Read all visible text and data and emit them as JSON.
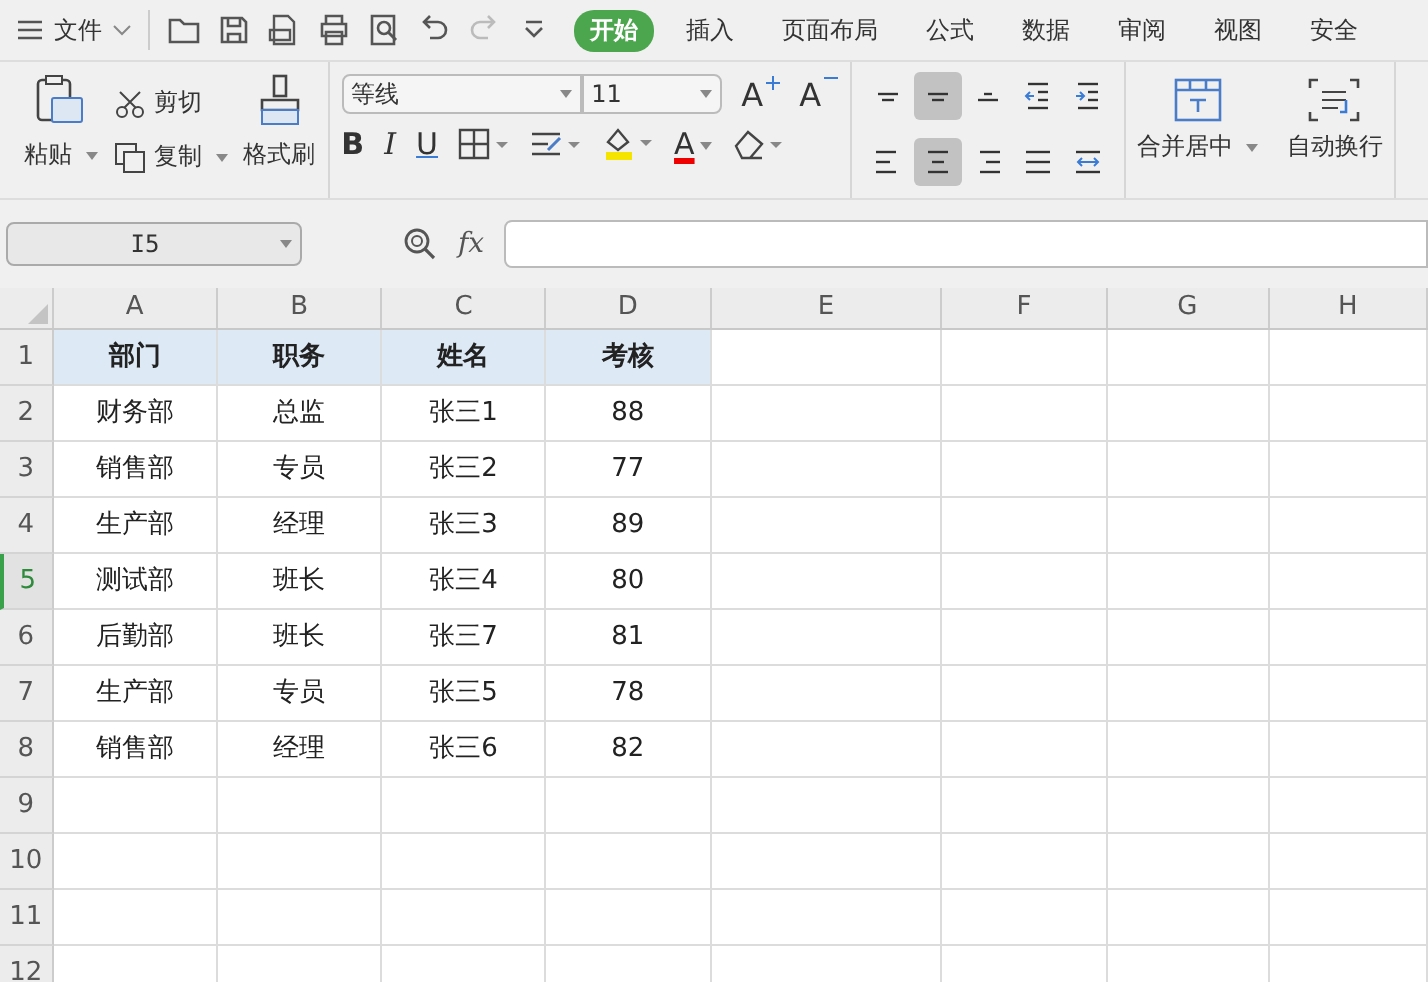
{
  "menu_bar": {
    "file_label": "文件",
    "tabs": [
      {
        "label": "开始",
        "selected": true
      },
      {
        "label": "插入",
        "selected": false
      },
      {
        "label": "页面布局",
        "selected": false
      },
      {
        "label": "公式",
        "selected": false
      },
      {
        "label": "数据",
        "selected": false
      },
      {
        "label": "审阅",
        "selected": false
      },
      {
        "label": "视图",
        "selected": false
      },
      {
        "label": "安全",
        "selected": false
      }
    ]
  },
  "ribbon": {
    "clipboard": {
      "paste": "粘贴",
      "cut": "剪切",
      "copy": "复制",
      "format_painter": "格式刷"
    },
    "font": {
      "family": "等线",
      "size": "11",
      "grow": "A",
      "shrink": "A",
      "bold": "B",
      "italic": "I",
      "underline": "U",
      "font_color": "A"
    },
    "alignment": [
      {
        "kind": "top",
        "selected": false
      },
      {
        "kind": "middle",
        "selected": true
      },
      {
        "kind": "bottom",
        "selected": false
      },
      {
        "kind": "outdent",
        "selected": false
      },
      {
        "kind": "indent",
        "selected": false
      },
      {
        "kind": "left",
        "selected": false
      },
      {
        "kind": "center",
        "selected": true
      },
      {
        "kind": "right",
        "selected": false
      },
      {
        "kind": "justify",
        "selected": false
      },
      {
        "kind": "distributed",
        "selected": false
      }
    ],
    "merge": "合并居中",
    "wrap": "自动换行"
  },
  "formula_bar": {
    "cell_ref": "I5",
    "fx": "fx"
  },
  "sheet": {
    "columns": [
      "A",
      "B",
      "C",
      "D",
      "E",
      "F",
      "G",
      "H"
    ],
    "rows": [
      {
        "number": "1",
        "kind": "heading",
        "selected": false,
        "cells": [
          "部门",
          "职务",
          "姓名",
          "考核"
        ]
      },
      {
        "number": "2",
        "kind": "data",
        "selected": false,
        "cells": [
          "财务部",
          "总监",
          "张三1",
          "88"
        ]
      },
      {
        "number": "3",
        "kind": "data",
        "selected": false,
        "cells": [
          "销售部",
          "专员",
          "张三2",
          "77"
        ]
      },
      {
        "number": "4",
        "kind": "data",
        "selected": false,
        "cells": [
          "生产部",
          "经理",
          "张三3",
          "89"
        ]
      },
      {
        "number": "5",
        "kind": "data",
        "selected": true,
        "cells": [
          "测试部",
          "班长",
          "张三4",
          "80"
        ]
      },
      {
        "number": "6",
        "kind": "data",
        "selected": false,
        "cells": [
          "后勤部",
          "班长",
          "张三7",
          "81"
        ]
      },
      {
        "number": "7",
        "kind": "data",
        "selected": false,
        "cells": [
          "生产部",
          "专员",
          "张三5",
          "78"
        ]
      },
      {
        "number": "8",
        "kind": "data",
        "selected": false,
        "cells": [
          "销售部",
          "经理",
          "张三6",
          "82"
        ]
      },
      {
        "number": "9",
        "kind": "empty",
        "selected": false
      },
      {
        "number": "10",
        "kind": "empty",
        "selected": false
      },
      {
        "number": "11",
        "kind": "empty",
        "selected": false
      },
      {
        "number": "12",
        "kind": "empty",
        "selected": false
      }
    ]
  }
}
